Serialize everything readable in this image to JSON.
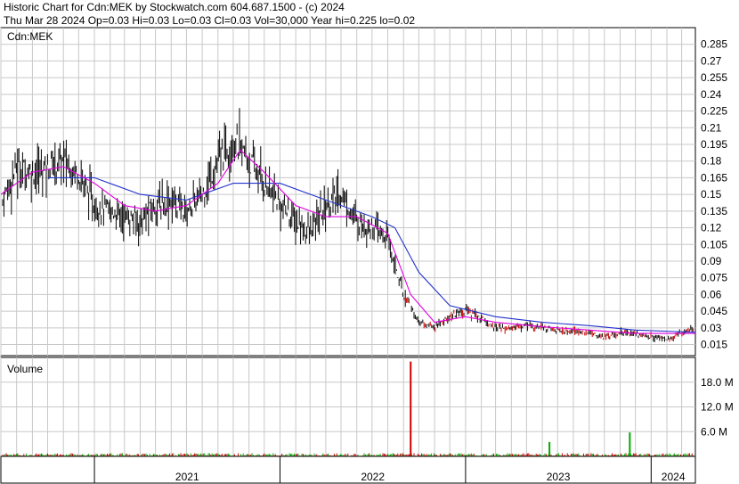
{
  "header": {
    "title": "Historic Chart for Cdn:MEK by Stockwatch.com 604.687.1500 - (c) 2024",
    "quote_line": "Thu Mar 28 2024  Op=0.03  Hi=0.03  Lo=0.03  Cl=0.03  Vol=30,000  Year hi=0.225  lo=0.02"
  },
  "colors": {
    "price_bar": "#000000",
    "price_bar_down": "#cc0000",
    "ma_short": "#e000e0",
    "ma_long": "#2233cc",
    "vol_up": "#00aa00",
    "vol_down": "#cc0000",
    "grid": "#c8c8c8"
  },
  "chart_data": [
    {
      "type": "line",
      "title": "Cdn:MEK",
      "ylim": [
        0.005,
        0.3
      ],
      "y_ticks": [
        "0.285",
        "0.27",
        "0.255",
        "0.24",
        "0.225",
        "0.21",
        "0.195",
        "0.18",
        "0.165",
        "0.15",
        "0.135",
        "0.12",
        "0.105",
        "0.09",
        "0.075",
        "0.06",
        "0.045",
        "0.03",
        "0.015"
      ],
      "x_labels": [
        "2021",
        "2022",
        "2023",
        "2024"
      ],
      "x_start": "2020-07-01",
      "x_end": "2024-03-28",
      "year_boundaries": [
        "2021-01-01",
        "2022-01-01",
        "2023-01-01",
        "2024-01-01"
      ],
      "series": [
        {
          "role": "price_close",
          "values": [
            [
              "2020-07-01",
              0.14
            ],
            [
              "2020-08-01",
              0.175
            ],
            [
              "2020-09-01",
              0.17
            ],
            [
              "2020-10-01",
              0.175
            ],
            [
              "2020-11-01",
              0.18
            ],
            [
              "2020-12-01",
              0.17
            ],
            [
              "2021-01-01",
              0.14
            ],
            [
              "2021-02-01",
              0.135
            ],
            [
              "2021-03-01",
              0.13
            ],
            [
              "2021-04-01",
              0.125
            ],
            [
              "2021-05-01",
              0.14
            ],
            [
              "2021-06-01",
              0.145
            ],
            [
              "2021-07-01",
              0.135
            ],
            [
              "2021-08-01",
              0.15
            ],
            [
              "2021-09-01",
              0.18
            ],
            [
              "2021-10-01",
              0.2
            ],
            [
              "2021-11-01",
              0.18
            ],
            [
              "2021-12-01",
              0.16
            ],
            [
              "2022-01-01",
              0.14
            ],
            [
              "2022-02-01",
              0.125
            ],
            [
              "2022-03-01",
              0.115
            ],
            [
              "2022-04-01",
              0.14
            ],
            [
              "2022-05-01",
              0.15
            ],
            [
              "2022-06-01",
              0.125
            ],
            [
              "2022-07-01",
              0.12
            ],
            [
              "2022-08-01",
              0.11
            ],
            [
              "2022-09-01",
              0.06
            ],
            [
              "2022-10-01",
              0.035
            ],
            [
              "2022-11-01",
              0.03
            ],
            [
              "2022-12-01",
              0.04
            ],
            [
              "2023-01-01",
              0.045
            ],
            [
              "2023-02-01",
              0.038
            ],
            [
              "2023-03-01",
              0.03
            ],
            [
              "2023-04-01",
              0.03
            ],
            [
              "2023-05-01",
              0.032
            ],
            [
              "2023-06-01",
              0.03
            ],
            [
              "2023-07-01",
              0.028
            ],
            [
              "2023-08-01",
              0.027
            ],
            [
              "2023-09-01",
              0.026
            ],
            [
              "2023-10-01",
              0.022
            ],
            [
              "2023-11-01",
              0.025
            ],
            [
              "2023-12-01",
              0.025
            ],
            [
              "2024-01-01",
              0.022
            ],
            [
              "2024-02-01",
              0.02
            ],
            [
              "2024-03-28",
              0.03
            ]
          ]
        },
        {
          "role": "moving_average_short",
          "values": [
            [
              "2020-07-01",
              0.15
            ],
            [
              "2020-09-01",
              0.17
            ],
            [
              "2020-11-01",
              0.175
            ],
            [
              "2021-01-01",
              0.16
            ],
            [
              "2021-03-01",
              0.14
            ],
            [
              "2021-05-01",
              0.135
            ],
            [
              "2021-07-01",
              0.14
            ],
            [
              "2021-09-01",
              0.16
            ],
            [
              "2021-10-15",
              0.19
            ],
            [
              "2021-12-01",
              0.17
            ],
            [
              "2022-02-01",
              0.14
            ],
            [
              "2022-04-01",
              0.13
            ],
            [
              "2022-06-01",
              0.13
            ],
            [
              "2022-08-01",
              0.115
            ],
            [
              "2022-09-15",
              0.06
            ],
            [
              "2022-11-01",
              0.035
            ],
            [
              "2023-01-01",
              0.04
            ],
            [
              "2023-03-01",
              0.035
            ],
            [
              "2023-06-01",
              0.031
            ],
            [
              "2023-09-01",
              0.028
            ],
            [
              "2023-12-01",
              0.025
            ],
            [
              "2024-03-28",
              0.025
            ]
          ]
        },
        {
          "role": "moving_average_long",
          "values": [
            [
              "2020-10-01",
              0.165
            ],
            [
              "2021-01-01",
              0.165
            ],
            [
              "2021-04-01",
              0.15
            ],
            [
              "2021-07-01",
              0.145
            ],
            [
              "2021-10-01",
              0.16
            ],
            [
              "2022-01-01",
              0.16
            ],
            [
              "2022-04-01",
              0.145
            ],
            [
              "2022-07-01",
              0.13
            ],
            [
              "2022-08-15",
              0.12
            ],
            [
              "2022-10-01",
              0.08
            ],
            [
              "2022-12-01",
              0.05
            ],
            [
              "2023-03-01",
              0.04
            ],
            [
              "2023-06-01",
              0.035
            ],
            [
              "2023-09-01",
              0.032
            ],
            [
              "2023-12-01",
              0.028
            ],
            [
              "2024-03-28",
              0.026
            ]
          ]
        }
      ]
    },
    {
      "type": "bar",
      "title": "Volume",
      "ylim": [
        0,
        24
      ],
      "y_unit": "M",
      "y_ticks": [
        "18.0 M",
        "12.0 M",
        "6.0 M"
      ],
      "spikes": [
        {
          "date": "2022-09-15",
          "value": 23.0,
          "color": "vol_down"
        },
        {
          "date": "2023-06-15",
          "value": 3.5,
          "color": "vol_up"
        },
        {
          "date": "2023-11-20",
          "value": 5.8,
          "color": "vol_up"
        }
      ],
      "baseline_level": 0.6
    }
  ]
}
